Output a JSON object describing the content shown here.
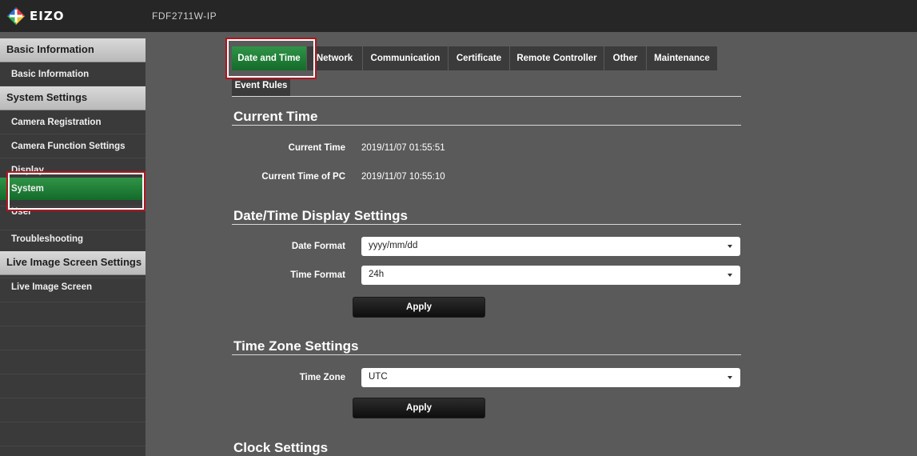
{
  "header": {
    "logo_text": "EIZO",
    "model": "FDF2711W-IP"
  },
  "sidebar": {
    "items": [
      {
        "label": "Basic Information",
        "kind": "category"
      },
      {
        "label": "Basic Information",
        "kind": "item"
      },
      {
        "label": "System Settings",
        "kind": "category"
      },
      {
        "label": "Camera Registration",
        "kind": "item"
      },
      {
        "label": "Camera Function Settings",
        "kind": "item"
      },
      {
        "label": "Display",
        "kind": "item"
      },
      {
        "label": "System",
        "kind": "item",
        "active": true
      },
      {
        "label": "User",
        "kind": "item"
      },
      {
        "label": "Troubleshooting",
        "kind": "item"
      },
      {
        "label": "Live Image Screen Settings",
        "kind": "category"
      },
      {
        "label": "Live Image Screen",
        "kind": "item"
      }
    ]
  },
  "tabs": [
    {
      "label": "Date and Time",
      "active": true
    },
    {
      "label": "Network"
    },
    {
      "label": "Communication"
    },
    {
      "label": "Certificate"
    },
    {
      "label": "Remote Controller"
    },
    {
      "label": "Other"
    },
    {
      "label": "Maintenance"
    },
    {
      "label": "Event Rules"
    }
  ],
  "current_time": {
    "title": "Current Time",
    "current_time_label": "Current Time",
    "current_time_value": "2019/11/07 01:55:51",
    "pc_time_label": "Current Time of PC",
    "pc_time_value": "2019/11/07 10:55:10"
  },
  "display_settings": {
    "title": "Date/Time Display Settings",
    "date_format_label": "Date Format",
    "date_format_value": "yyyy/mm/dd",
    "time_format_label": "Time Format",
    "time_format_value": "24h",
    "apply_label": "Apply"
  },
  "timezone_settings": {
    "title": "Time Zone Settings",
    "timezone_label": "Time Zone",
    "timezone_value": "UTC",
    "apply_label": "Apply"
  },
  "clock_settings": {
    "title": "Clock Settings"
  },
  "colors": {
    "accent_green": "#1f7f37",
    "highlight_red": "#b4141e",
    "background": "#5a5a5a",
    "topbar": "#262626"
  }
}
